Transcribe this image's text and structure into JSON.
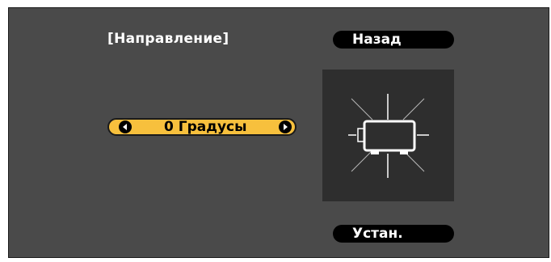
{
  "menu": {
    "title": "[Направление]",
    "back_label": "Назад",
    "set_label": "Устан."
  },
  "direction": {
    "value": "0 Градусы"
  },
  "colors": {
    "panel_background": "#4a4a4a",
    "selector_highlight": "#f7c03d",
    "button_background": "#000000",
    "preview_background": "#2e2e2e"
  },
  "icons": {
    "selector_left": "arrow-left-icon",
    "selector_right": "arrow-right-icon",
    "preview": "projector-icon"
  }
}
